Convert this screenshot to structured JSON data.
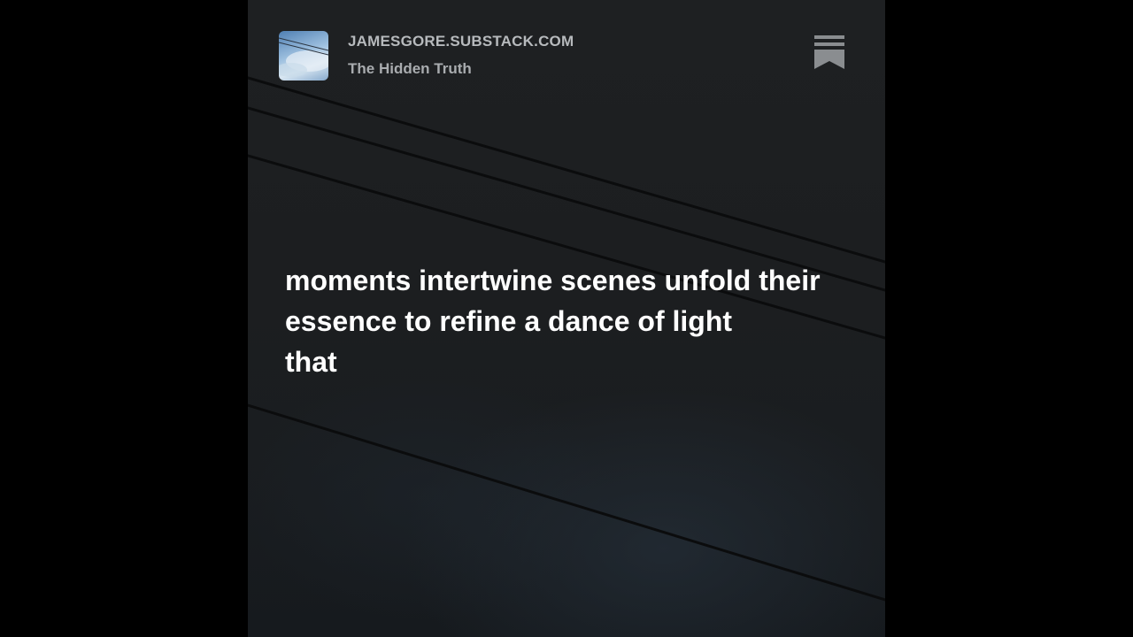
{
  "header": {
    "site_url": "JAMESGORE.SUBSTACK.COM",
    "publication": "The Hidden Truth"
  },
  "icons": {
    "thumbnail": "sky-photo-thumbnail",
    "logo": "substack-logo-icon"
  },
  "poem": {
    "lines": [
      "moments intertwine scenes unfold their",
      "essence to refine a dance of light",
      "that"
    ]
  },
  "colors": {
    "outer_background": "#000000",
    "frame_background": "#1c1e20",
    "text_primary": "#ffffff",
    "text_secondary": "#b7babd",
    "logo": "#8a8d90"
  }
}
